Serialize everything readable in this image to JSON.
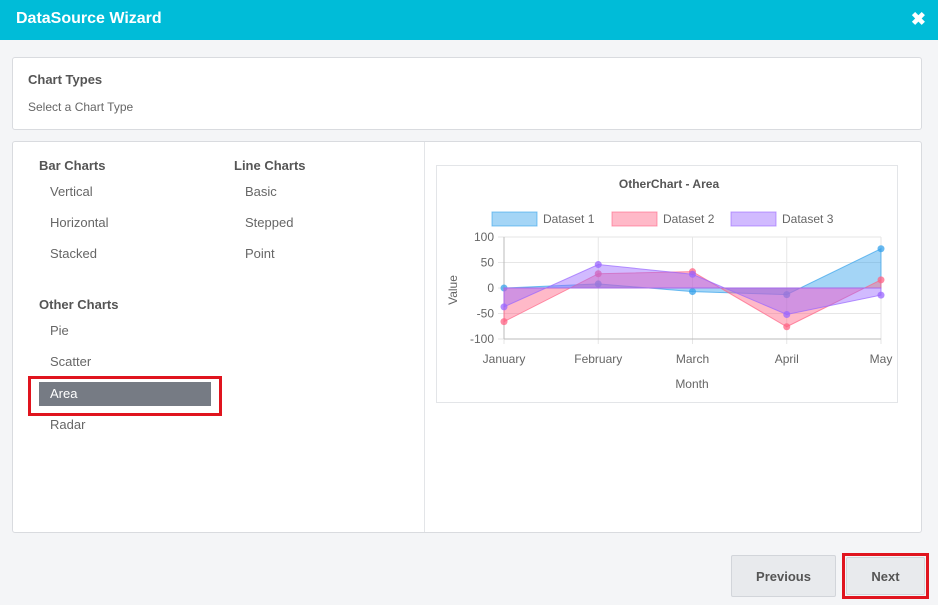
{
  "window": {
    "title": "DataSource Wizard",
    "close_glyph": "✖"
  },
  "header": {
    "title": "Chart Types",
    "subtitle": "Select a Chart Type"
  },
  "groups": {
    "bar": {
      "title": "Bar Charts",
      "items": [
        "Vertical",
        "Horizontal",
        "Stacked"
      ]
    },
    "line": {
      "title": "Line Charts",
      "items": [
        "Basic",
        "Stepped",
        "Point"
      ]
    },
    "other": {
      "title": "Other Charts",
      "items": [
        "Pie",
        "Scatter",
        "Area",
        "Radar"
      ],
      "selected": "Area"
    }
  },
  "chart_data": {
    "type": "area",
    "title": "OtherChart - Area",
    "xlabel": "Month",
    "ylabel": "Value",
    "categories": [
      "January",
      "February",
      "March",
      "April",
      "May"
    ],
    "ylim": [
      -100,
      100
    ],
    "yticks": [
      "100",
      "50",
      "0",
      "-50",
      "-100"
    ],
    "legend_position": "top",
    "series": [
      {
        "name": "Dataset 1",
        "color": "#36a2eb",
        "values": [
          0,
          8,
          -7,
          -13,
          77
        ]
      },
      {
        "name": "Dataset 2",
        "color": "#ff6384",
        "values": [
          -66,
          28,
          32,
          -76,
          16
        ]
      },
      {
        "name": "Dataset 3",
        "color": "#9966ff",
        "values": [
          -37,
          46,
          27,
          -52,
          -14
        ]
      }
    ]
  },
  "buttons": {
    "previous": "Previous",
    "next": "Next"
  }
}
